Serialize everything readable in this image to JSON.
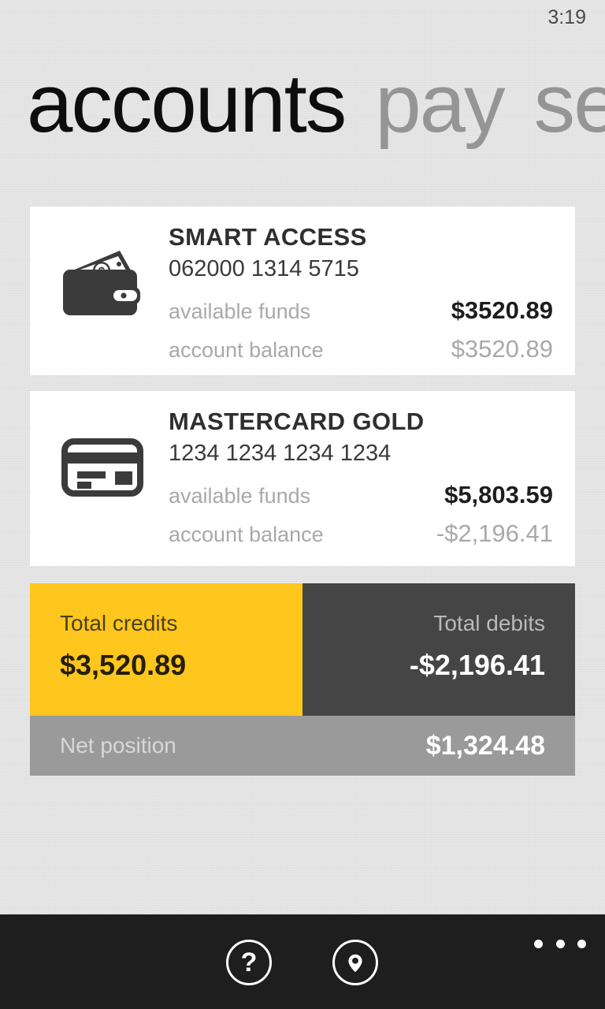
{
  "status_bar": {
    "time": "3:19"
  },
  "header": {
    "active_title": "accounts",
    "next_title": "pay",
    "third_title": "se"
  },
  "accounts": [
    {
      "icon": "wallet-icon",
      "title": "SMART ACCESS",
      "number": "062000 1314 5715",
      "available_label": "available funds",
      "available_value": "$3520.89",
      "balance_label": "account balance",
      "balance_value": "$3520.89"
    },
    {
      "icon": "credit-card-icon",
      "title": "MASTERCARD GOLD",
      "number": "1234 1234 1234 1234",
      "available_label": "available funds",
      "available_value": "$5,803.59",
      "balance_label": "account balance",
      "balance_value": "-$2,196.41"
    }
  ],
  "summary": {
    "credits_label": "Total credits",
    "credits_value": "$3,520.89",
    "debits_label": "Total debits",
    "debits_value": "-$2,196.41",
    "net_label": "Net position",
    "net_value": "$1,324.48"
  },
  "appbar": {
    "help_glyph": "?",
    "help_name": "help",
    "locate_name": "find locations",
    "overflow_name": "more"
  },
  "colors": {
    "page_background": "#e4e4e4",
    "card_background": "#ffffff",
    "accent_yellow": "#FFC61E",
    "dark_tile": "#454545",
    "net_tile": "#9a9a9a",
    "appbar": "#1e1e1e",
    "muted_text": "#a9a9a9"
  }
}
